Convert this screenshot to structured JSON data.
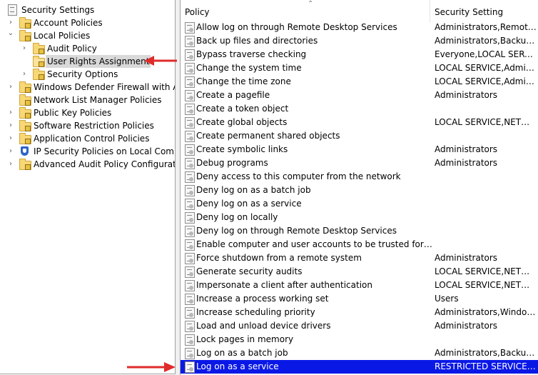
{
  "tree": [
    {
      "label": "Security Settings",
      "indent": 0,
      "expander": "",
      "icon": "security-settings-icon"
    },
    {
      "label": "Account Policies",
      "indent": 1,
      "expander": ">",
      "icon": "folder-icon"
    },
    {
      "label": "Local Policies",
      "indent": 1,
      "expander": "v",
      "icon": "folder-icon"
    },
    {
      "label": "Audit Policy",
      "indent": 2,
      "expander": ">",
      "icon": "folder-icon"
    },
    {
      "label": "User Rights Assignment",
      "indent": 2,
      "expander": "",
      "icon": "folder-open-icon",
      "selected": true
    },
    {
      "label": "Security Options",
      "indent": 2,
      "expander": ">",
      "icon": "folder-icon"
    },
    {
      "label": "Windows Defender Firewall with Advanced Security",
      "indent": 1,
      "expander": ">",
      "icon": "folder-icon"
    },
    {
      "label": "Network List Manager Policies",
      "indent": 1,
      "expander": "",
      "icon": "folder-icon"
    },
    {
      "label": "Public Key Policies",
      "indent": 1,
      "expander": ">",
      "icon": "folder-icon"
    },
    {
      "label": "Software Restriction Policies",
      "indent": 1,
      "expander": ">",
      "icon": "folder-icon"
    },
    {
      "label": "Application Control Policies",
      "indent": 1,
      "expander": ">",
      "icon": "folder-icon"
    },
    {
      "label": "IP Security Policies on Local Computer",
      "indent": 1,
      "expander": ">",
      "icon": "shield-icon"
    },
    {
      "label": "Advanced Audit Policy Configuration",
      "indent": 1,
      "expander": ">",
      "icon": "folder-icon"
    }
  ],
  "list": {
    "headers": {
      "policy": "Policy",
      "security": "Security Setting"
    },
    "rows": [
      {
        "policy": "Allow log on through Remote Desktop Services",
        "security": "Administrators,Remote ..."
      },
      {
        "policy": "Back up files and directories",
        "security": "Administrators,Backup ..."
      },
      {
        "policy": "Bypass traverse checking",
        "security": "Everyone,LOCAL SERVIC..."
      },
      {
        "policy": "Change the system time",
        "security": "LOCAL SERVICE,Admini..."
      },
      {
        "policy": "Change the time zone",
        "security": "LOCAL SERVICE,Admini..."
      },
      {
        "policy": "Create a pagefile",
        "security": "Administrators"
      },
      {
        "policy": "Create a token object",
        "security": ""
      },
      {
        "policy": "Create global objects",
        "security": "LOCAL SERVICE,NETWO..."
      },
      {
        "policy": "Create permanent shared objects",
        "security": ""
      },
      {
        "policy": "Create symbolic links",
        "security": "Administrators"
      },
      {
        "policy": "Debug programs",
        "security": "Administrators"
      },
      {
        "policy": "Deny access to this computer from the network",
        "security": ""
      },
      {
        "policy": "Deny log on as a batch job",
        "security": ""
      },
      {
        "policy": "Deny log on as a service",
        "security": ""
      },
      {
        "policy": "Deny log on locally",
        "security": ""
      },
      {
        "policy": "Deny log on through Remote Desktop Services",
        "security": ""
      },
      {
        "policy": "Enable computer and user accounts to be trusted for delega...",
        "security": ""
      },
      {
        "policy": "Force shutdown from a remote system",
        "security": "Administrators"
      },
      {
        "policy": "Generate security audits",
        "security": "LOCAL SERVICE,NETWO..."
      },
      {
        "policy": "Impersonate a client after authentication",
        "security": "LOCAL SERVICE,NETWO..."
      },
      {
        "policy": "Increase a process working set",
        "security": "Users"
      },
      {
        "policy": "Increase scheduling priority",
        "security": "Administrators,Window ..."
      },
      {
        "policy": "Load and unload device drivers",
        "security": "Administrators"
      },
      {
        "policy": "Lock pages in memory",
        "security": ""
      },
      {
        "policy": "Log on as a batch job",
        "security": "Administrators,Backup ..."
      },
      {
        "policy": "Log on as a service",
        "security": "RESTRICTED SERVICES\\...",
        "selected": true
      }
    ]
  },
  "colors": {
    "selection": "#0a18e6",
    "arrow": "#e02b2b"
  }
}
